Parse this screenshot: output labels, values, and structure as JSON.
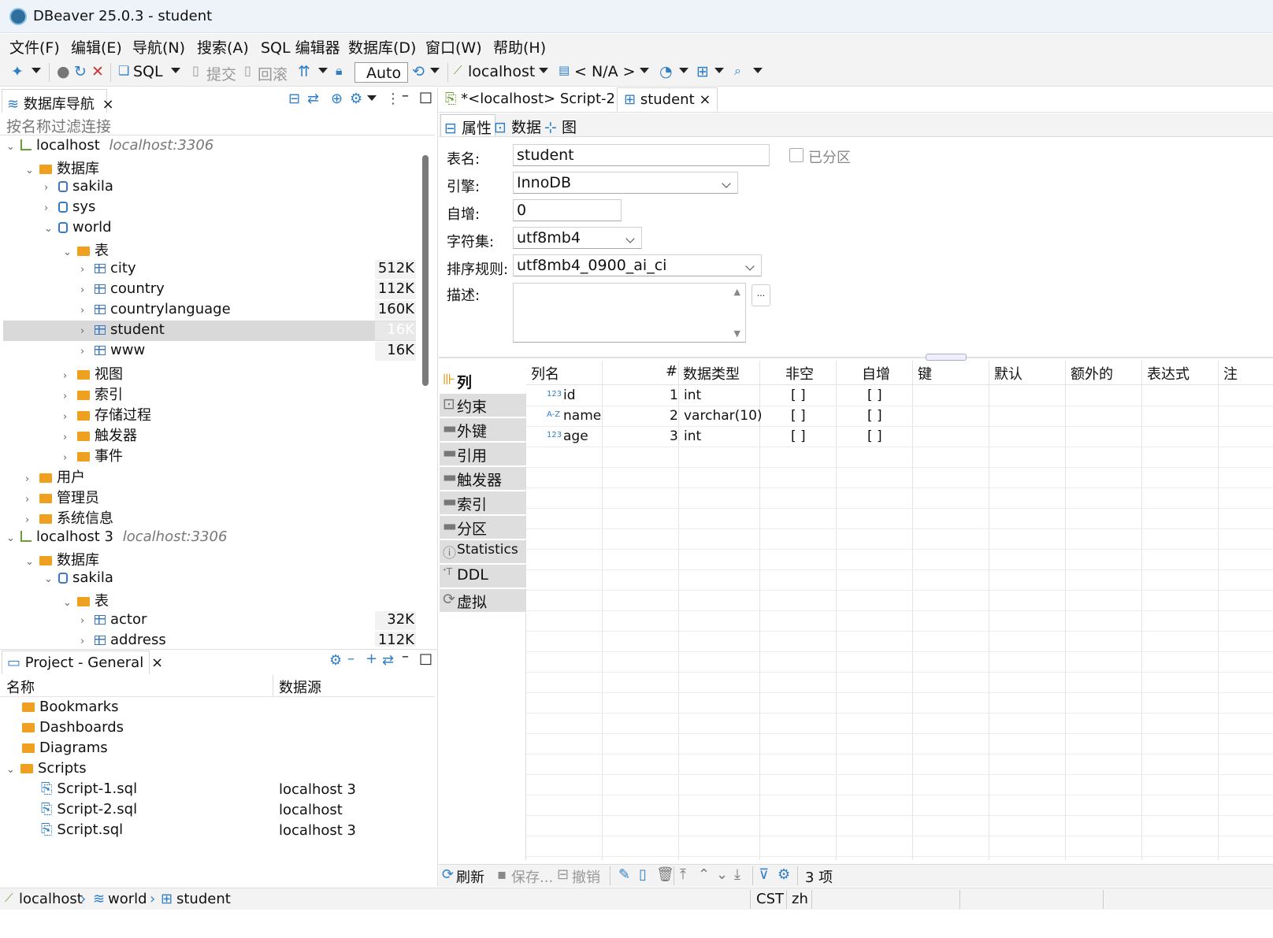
{
  "window": {
    "title": "DBeaver 25.0.3 - student"
  },
  "menu": [
    "文件(F)",
    "编辑(E)",
    "导航(N)",
    "搜索(A)",
    "SQL 编辑器",
    "数据库(D)",
    "窗口(W)",
    "帮助(H)"
  ],
  "toolbar": {
    "sql": "SQL",
    "commit": "提交",
    "rollback": "回滚",
    "tx_mode": "Auto",
    "connection": "localhost",
    "schema": "< N/A >"
  },
  "navigator": {
    "tab_label": "数据库导航",
    "filter_placeholder": "按名称过滤连接",
    "nodes": [
      {
        "label": "localhost",
        "sub": "localhost:3306"
      },
      {
        "label": "数据库"
      },
      {
        "label": "sakila"
      },
      {
        "label": "sys"
      },
      {
        "label": "world"
      },
      {
        "label": "表"
      },
      {
        "label": "city",
        "size": "512K"
      },
      {
        "label": "country",
        "size": "112K"
      },
      {
        "label": "countrylanguage",
        "size": "160K"
      },
      {
        "label": "student",
        "size": "16K"
      },
      {
        "label": "www",
        "size": "16K"
      },
      {
        "label": "视图"
      },
      {
        "label": "索引"
      },
      {
        "label": "存储过程"
      },
      {
        "label": "触发器"
      },
      {
        "label": "事件"
      },
      {
        "label": "用户"
      },
      {
        "label": "管理员"
      },
      {
        "label": "系统信息"
      },
      {
        "label": "localhost 3",
        "sub": "localhost:3306"
      },
      {
        "label": "数据库"
      },
      {
        "label": "sakila"
      },
      {
        "label": "表"
      },
      {
        "label": "actor",
        "size": "32K"
      },
      {
        "label": "address",
        "size": "112K"
      }
    ]
  },
  "project": {
    "tab_label": "Project - General",
    "col_name": "名称",
    "col_source": "数据源",
    "rows": [
      {
        "name": "Bookmarks",
        "source": ""
      },
      {
        "name": "Dashboards",
        "source": ""
      },
      {
        "name": "Diagrams",
        "source": ""
      },
      {
        "name": "Scripts",
        "source": ""
      },
      {
        "name": "Script-1.sql",
        "source": "localhost 3"
      },
      {
        "name": "Script-2.sql",
        "source": "localhost"
      },
      {
        "name": "Script.sql",
        "source": "localhost 3"
      }
    ]
  },
  "editor": {
    "tabs": [
      "*<localhost> Script-2",
      "student"
    ],
    "subtabs": [
      "属性",
      "数据",
      "图"
    ],
    "props": {
      "table_name_label": "表名:",
      "table_name": "student",
      "partitioned_label": "已分区",
      "engine_label": "引擎:",
      "engine": "InnoDB",
      "autoinc_label": "自增:",
      "autoinc": "0",
      "charset_label": "字符集:",
      "charset": "utf8mb4",
      "collation_label": "排序规则:",
      "collation": "utf8mb4_0900_ai_ci",
      "desc_label": "描述:",
      "desc_btn": "..."
    },
    "side_tabs": [
      "列",
      "约束",
      "外键",
      "引用",
      "触发器",
      "索引",
      "分区",
      "Statistics",
      "DDL",
      "虚拟"
    ],
    "columns_header": [
      "列名",
      "#",
      "数据类型",
      "非空",
      "自增",
      "键",
      "默认",
      "额外的",
      "表达式",
      "注"
    ],
    "columns": [
      {
        "type_icon": "123",
        "name": "id",
        "num": "1",
        "dtype": "int",
        "notnull": "[ ]",
        "autoinc": "[ ]"
      },
      {
        "type_icon": "A-Z",
        "name": "name",
        "num": "2",
        "dtype": "varchar(10)",
        "notnull": "[ ]",
        "autoinc": "[ ]"
      },
      {
        "type_icon": "123",
        "name": "age",
        "num": "3",
        "dtype": "int",
        "notnull": "[ ]",
        "autoinc": "[ ]"
      }
    ],
    "bottom": {
      "refresh": "刷新",
      "save": "保存...",
      "revert": "撤销",
      "count": "3 项"
    }
  },
  "status": {
    "crumb1": "localhost",
    "crumb2": "world",
    "crumb3": "student",
    "tz": "CST",
    "locale": "zh"
  }
}
